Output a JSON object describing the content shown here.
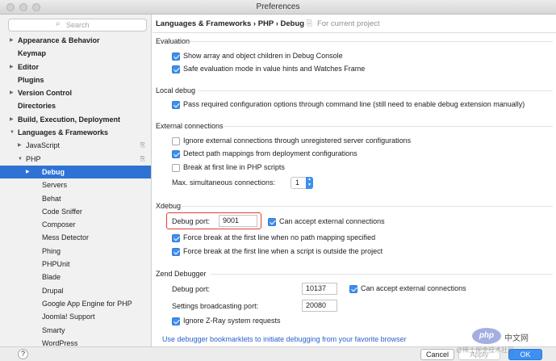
{
  "window": {
    "title": "Preferences"
  },
  "search": {
    "placeholder": "Search"
  },
  "sidebar": {
    "items": [
      {
        "label": "Appearance & Behavior",
        "bold": true,
        "arrow": "right",
        "indent": 0
      },
      {
        "label": "Keymap",
        "bold": true,
        "arrow": "",
        "indent": 0
      },
      {
        "label": "Editor",
        "bold": true,
        "arrow": "right",
        "indent": 0
      },
      {
        "label": "Plugins",
        "bold": true,
        "arrow": "",
        "indent": 0
      },
      {
        "label": "Version Control",
        "bold": true,
        "arrow": "right",
        "indent": 0
      },
      {
        "label": "Directories",
        "bold": true,
        "arrow": "",
        "indent": 0
      },
      {
        "label": "Build, Execution, Deployment",
        "bold": true,
        "arrow": "right",
        "indent": 0
      },
      {
        "label": "Languages & Frameworks",
        "bold": true,
        "arrow": "down",
        "indent": 0
      },
      {
        "label": "JavaScript",
        "bold": false,
        "arrow": "right",
        "indent": 1,
        "project_icon": true
      },
      {
        "label": "PHP",
        "bold": false,
        "arrow": "down",
        "indent": 1,
        "project_icon": true
      },
      {
        "label": "Debug",
        "bold": true,
        "arrow": "right",
        "indent": 2,
        "selected": true
      },
      {
        "label": "Servers",
        "bold": false,
        "arrow": "",
        "indent": 2
      },
      {
        "label": "Behat",
        "bold": false,
        "arrow": "",
        "indent": 2
      },
      {
        "label": "Code Sniffer",
        "bold": false,
        "arrow": "",
        "indent": 2
      },
      {
        "label": "Composer",
        "bold": false,
        "arrow": "",
        "indent": 2
      },
      {
        "label": "Mess Detector",
        "bold": false,
        "arrow": "",
        "indent": 2
      },
      {
        "label": "Phing",
        "bold": false,
        "arrow": "",
        "indent": 2
      },
      {
        "label": "PHPUnit",
        "bold": false,
        "arrow": "",
        "indent": 2
      },
      {
        "label": "Blade",
        "bold": false,
        "arrow": "",
        "indent": 2
      },
      {
        "label": "Drupal",
        "bold": false,
        "arrow": "",
        "indent": 2
      },
      {
        "label": "Google App Engine for PHP",
        "bold": false,
        "arrow": "",
        "indent": 2
      },
      {
        "label": "Joomla! Support",
        "bold": false,
        "arrow": "",
        "indent": 2
      },
      {
        "label": "Smarty",
        "bold": false,
        "arrow": "",
        "indent": 2
      },
      {
        "label": "WordPress",
        "bold": false,
        "arrow": "",
        "indent": 2
      }
    ]
  },
  "breadcrumb": {
    "path": "Languages & Frameworks › PHP › Debug",
    "project_note": "For current project"
  },
  "evaluation": {
    "title": "Evaluation",
    "options": [
      {
        "label": "Show array and object children in Debug Console",
        "checked": true
      },
      {
        "label": "Safe evaluation mode in value hints and Watches Frame",
        "checked": true
      }
    ]
  },
  "local_debug": {
    "title": "Local debug",
    "options": [
      {
        "label": "Pass required configuration options through command line (still need to enable debug extension manually)",
        "checked": true
      }
    ]
  },
  "external": {
    "title": "External connections",
    "options": [
      {
        "label": "Ignore external connections through unregistered server configurations",
        "checked": false
      },
      {
        "label": "Detect path mappings from deployment configurations",
        "checked": true
      },
      {
        "label": "Break at first line in PHP scripts",
        "checked": false
      }
    ],
    "max_label": "Max. simultaneous connections:",
    "max_value": "1"
  },
  "xdebug": {
    "title": "Xdebug",
    "port_label": "Debug port:",
    "port_value": "9001",
    "accept_label": "Can accept external connections",
    "accept_checked": true,
    "options": [
      {
        "label": "Force break at the first line when no path mapping specified",
        "checked": true
      },
      {
        "label": "Force break at the first line when a script is outside the project",
        "checked": true
      }
    ]
  },
  "zend": {
    "title": "Zend Debugger",
    "port_label": "Debug port:",
    "port_value": "10137",
    "accept_label": "Can accept external connections",
    "accept_checked": true,
    "broadcast_label": "Settings broadcasting port:",
    "broadcast_value": "20080",
    "ignore_label": "Ignore Z-Ray system requests",
    "ignore_checked": true
  },
  "bookmarklet_link": "Use debugger bookmarklets to initiate debugging from your favorite browser",
  "buttons": {
    "help": "?",
    "cancel": "Cancel",
    "apply": "Apply",
    "ok": "OK"
  },
  "watermark": {
    "logo": "php",
    "text": "中文网",
    "sub": "@稀土掘金技术社区"
  },
  "colors": {
    "accent": "#3d8ff0",
    "selection": "#2e72d6",
    "highlight": "#e23a3a",
    "link": "#2b62c9"
  }
}
